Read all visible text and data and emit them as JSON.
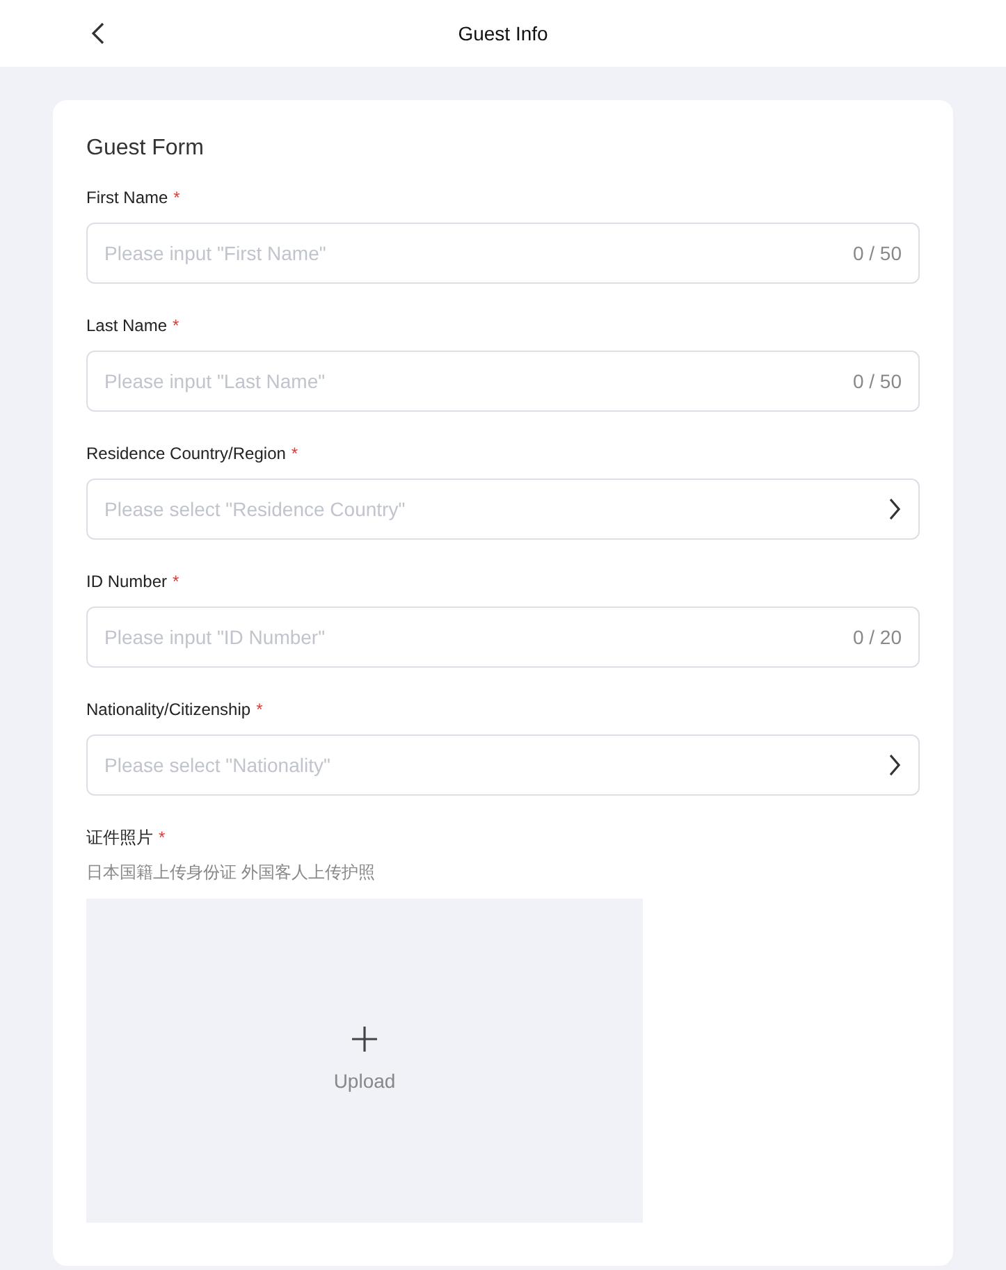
{
  "header": {
    "title": "Guest Info"
  },
  "form": {
    "title": "Guest Form",
    "required_mark": "*",
    "fields": [
      {
        "kind": "input",
        "label": "First Name",
        "required": true,
        "placeholder": "Please input \"First Name\"",
        "counter": "0 / 50"
      },
      {
        "kind": "input",
        "label": "Last Name",
        "required": true,
        "placeholder": "Please input \"Last Name\"",
        "counter": "0 / 50"
      },
      {
        "kind": "select",
        "label": "Residence Country/Region",
        "required": true,
        "placeholder": "Please select \"Residence Country\""
      },
      {
        "kind": "input",
        "label": "ID Number",
        "required": true,
        "placeholder": "Please input \"ID Number\"",
        "counter": "0 / 20"
      },
      {
        "kind": "select",
        "label": "Nationality/Citizenship",
        "required": true,
        "placeholder": "Please select \"Nationality\""
      }
    ],
    "photo": {
      "label": "证件照片",
      "required": true,
      "hint": "日本国籍上传身份证 外国客人上传护照",
      "upload_label": "Upload"
    }
  }
}
